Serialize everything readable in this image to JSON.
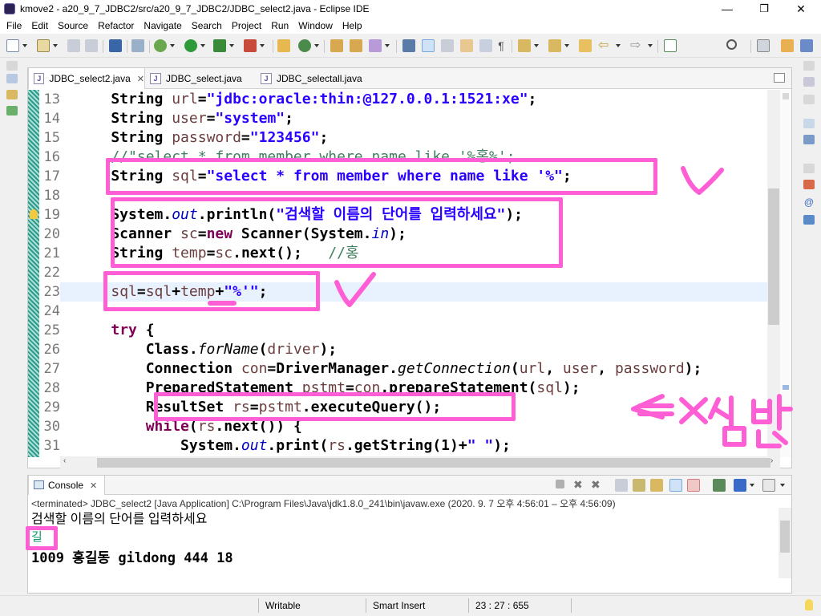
{
  "window": {
    "title": "kmove2 - a20_9_7_JDBC2/src/a20_9_7_JDBC2/JDBC_select2.java - Eclipse IDE",
    "minimize": "—",
    "maximize": "❐",
    "close": "✕"
  },
  "menu": [
    "File",
    "Edit",
    "Source",
    "Refactor",
    "Navigate",
    "Search",
    "Project",
    "Run",
    "Window",
    "Help"
  ],
  "tabs": [
    {
      "label": "JDBC_select2.java",
      "close": "✕"
    },
    {
      "label": "JDBC_select.java"
    },
    {
      "label": "JDBC_selectall.java"
    }
  ],
  "editor": {
    "lines": [
      {
        "num": "13",
        "parts": [
          {
            "t": "    String ",
            "c": ""
          },
          {
            "t": "url",
            "c": "var"
          },
          {
            "t": "=",
            "c": ""
          },
          {
            "t": "\"jdbc:oracle:thin:@127.0.0.1:1521:xe\"",
            "c": "str"
          },
          {
            "t": ";",
            "c": ""
          }
        ]
      },
      {
        "num": "14",
        "parts": [
          {
            "t": "    String ",
            "c": ""
          },
          {
            "t": "user",
            "c": "var"
          },
          {
            "t": "=",
            "c": ""
          },
          {
            "t": "\"system\"",
            "c": "str"
          },
          {
            "t": ";",
            "c": ""
          }
        ]
      },
      {
        "num": "15",
        "parts": [
          {
            "t": "    String ",
            "c": ""
          },
          {
            "t": "password",
            "c": "var"
          },
          {
            "t": "=",
            "c": ""
          },
          {
            "t": "\"123456\"",
            "c": "str"
          },
          {
            "t": ";",
            "c": ""
          }
        ]
      },
      {
        "num": "16",
        "parts": [
          {
            "t": "    //\"select * from member where name like '%홍%';",
            "c": "com"
          }
        ]
      },
      {
        "num": "17",
        "parts": [
          {
            "t": "    String ",
            "c": ""
          },
          {
            "t": "sql",
            "c": "var"
          },
          {
            "t": "=",
            "c": ""
          },
          {
            "t": "\"select * from member where name like '%\"",
            "c": "str"
          },
          {
            "t": ";",
            "c": ""
          }
        ]
      },
      {
        "num": "18",
        "parts": [
          {
            "t": "",
            "c": ""
          }
        ]
      },
      {
        "num": "19",
        "parts": [
          {
            "t": "    System.",
            "c": ""
          },
          {
            "t": "out",
            "c": "it"
          },
          {
            "t": ".println(",
            "c": ""
          },
          {
            "t": "\"검색할 이름의 단어를 입력하세요\"",
            "c": "str"
          },
          {
            "t": ");",
            "c": ""
          }
        ]
      },
      {
        "num": "20",
        "parts": [
          {
            "t": "    Scanner ",
            "c": ""
          },
          {
            "t": "sc",
            "c": "var"
          },
          {
            "t": "=",
            "c": ""
          },
          {
            "t": "new",
            "c": "kw"
          },
          {
            "t": " Scanner(System.",
            "c": ""
          },
          {
            "t": "in",
            "c": "it"
          },
          {
            "t": ");",
            "c": ""
          }
        ]
      },
      {
        "num": "21",
        "parts": [
          {
            "t": "    String ",
            "c": ""
          },
          {
            "t": "temp",
            "c": "var"
          },
          {
            "t": "=",
            "c": ""
          },
          {
            "t": "sc",
            "c": "var"
          },
          {
            "t": ".next();   ",
            "c": ""
          },
          {
            "t": "//홍",
            "c": "com"
          }
        ]
      },
      {
        "num": "22",
        "parts": [
          {
            "t": "",
            "c": ""
          }
        ]
      },
      {
        "num": "23",
        "parts": [
          {
            "t": "    ",
            "c": ""
          },
          {
            "t": "sql",
            "c": "var"
          },
          {
            "t": "=",
            "c": ""
          },
          {
            "t": "sql",
            "c": "var"
          },
          {
            "t": "+",
            "c": ""
          },
          {
            "t": "temp",
            "c": "var"
          },
          {
            "t": "+",
            "c": ""
          },
          {
            "t": "\"%'\"",
            "c": "str"
          },
          {
            "t": ";",
            "c": ""
          }
        ]
      },
      {
        "num": "24",
        "parts": [
          {
            "t": "",
            "c": ""
          }
        ]
      },
      {
        "num": "25",
        "parts": [
          {
            "t": "    ",
            "c": ""
          },
          {
            "t": "try",
            "c": "kw"
          },
          {
            "t": " {",
            "c": ""
          }
        ]
      },
      {
        "num": "26",
        "parts": [
          {
            "t": "        Class.",
            "c": ""
          },
          {
            "t": "forName",
            "c": "mi"
          },
          {
            "t": "(",
            "c": ""
          },
          {
            "t": "driver",
            "c": "var"
          },
          {
            "t": ");",
            "c": ""
          }
        ]
      },
      {
        "num": "27",
        "parts": [
          {
            "t": "        Connection ",
            "c": ""
          },
          {
            "t": "con",
            "c": "var"
          },
          {
            "t": "=DriverManager.",
            "c": ""
          },
          {
            "t": "getConnection",
            "c": "mi"
          },
          {
            "t": "(",
            "c": ""
          },
          {
            "t": "url",
            "c": "var"
          },
          {
            "t": ", ",
            "c": ""
          },
          {
            "t": "user",
            "c": "var"
          },
          {
            "t": ", ",
            "c": ""
          },
          {
            "t": "password",
            "c": "var"
          },
          {
            "t": ");",
            "c": ""
          }
        ]
      },
      {
        "num": "28",
        "parts": [
          {
            "t": "        PreparedStatement ",
            "c": ""
          },
          {
            "t": "pstmt",
            "c": "var"
          },
          {
            "t": "=",
            "c": ""
          },
          {
            "t": "con",
            "c": "var"
          },
          {
            "t": ".prepareStatement(",
            "c": ""
          },
          {
            "t": "sql",
            "c": "var"
          },
          {
            "t": ");",
            "c": ""
          }
        ]
      },
      {
        "num": "29",
        "parts": [
          {
            "t": "        ResultSet ",
            "c": ""
          },
          {
            "t": "rs",
            "c": "var"
          },
          {
            "t": "=",
            "c": ""
          },
          {
            "t": "pstmt",
            "c": "var"
          },
          {
            "t": ".executeQuery();",
            "c": ""
          }
        ]
      },
      {
        "num": "30",
        "parts": [
          {
            "t": "        ",
            "c": ""
          },
          {
            "t": "while",
            "c": "kw"
          },
          {
            "t": "(",
            "c": ""
          },
          {
            "t": "rs",
            "c": "var"
          },
          {
            "t": ".next()) {",
            "c": ""
          }
        ]
      },
      {
        "num": "31",
        "parts": [
          {
            "t": "            System.",
            "c": ""
          },
          {
            "t": "out",
            "c": "it"
          },
          {
            "t": ".print(",
            "c": ""
          },
          {
            "t": "rs",
            "c": "var"
          },
          {
            "t": ".getString(1)+",
            "c": ""
          },
          {
            "t": "\" \"",
            "c": "str"
          },
          {
            "t": ");",
            "c": ""
          }
        ]
      }
    ]
  },
  "console": {
    "tab_label": "Console",
    "tab_close": "✕",
    "info": "<terminated> JDBC_select2 [Java Application] C:\\Program Files\\Java\\jdk1.8.0_241\\bin\\javaw.exe  (2020. 9. 7 오후 4:56:01 – 오후 4:56:09)",
    "prompt": "검색할 이름의 단어를 입력하세요",
    "input": "길",
    "output": "1009 홍길동 gildong 444 18"
  },
  "status": {
    "mode": "Writable",
    "insert": "Smart Insert",
    "position": "23 : 27 : 655"
  },
  "annotation": {
    "color": "#ff5ed5",
    "scribble": "<=x 삽입"
  }
}
